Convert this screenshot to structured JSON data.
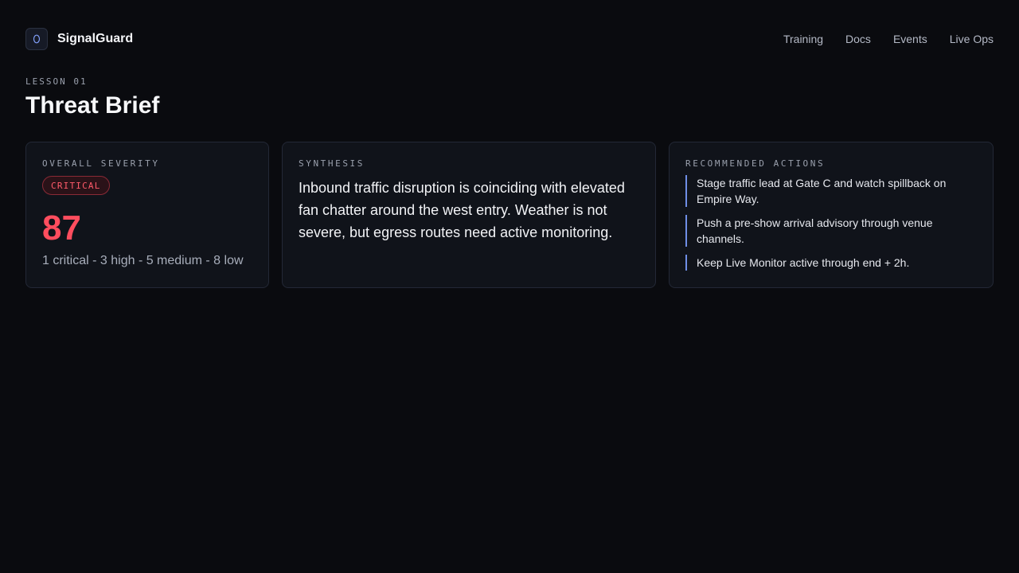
{
  "brand": {
    "name": "SignalGuard",
    "logo_glyph": "O"
  },
  "nav": [
    "Training",
    "Docs",
    "Events",
    "Live Ops"
  ],
  "page": {
    "eyebrow": "LESSON 01",
    "title": "Threat Brief"
  },
  "severity": {
    "label": "OVERALL SEVERITY",
    "badge": "CRITICAL",
    "score": "87",
    "breakdown": "1 critical - 3 high - 5 medium - 8 low"
  },
  "synthesis": {
    "label": "SYNTHESIS",
    "text": "Inbound traffic disruption is coinciding with elevated fan chatter around the west entry. Weather is not severe, but egress routes need active monitoring."
  },
  "actions": {
    "label": "RECOMMENDED ACTIONS",
    "items": [
      "Stage traffic lead at Gate C and watch spillback on Empire Way.",
      "Push a pre-show arrival advisory through venue channels.",
      "Keep Live Monitor active through end + 2h."
    ]
  },
  "colors": {
    "background": "#0a0b0f",
    "card": "#10131a",
    "critical": "#ff4d5e",
    "accent": "#6f8ee6"
  }
}
